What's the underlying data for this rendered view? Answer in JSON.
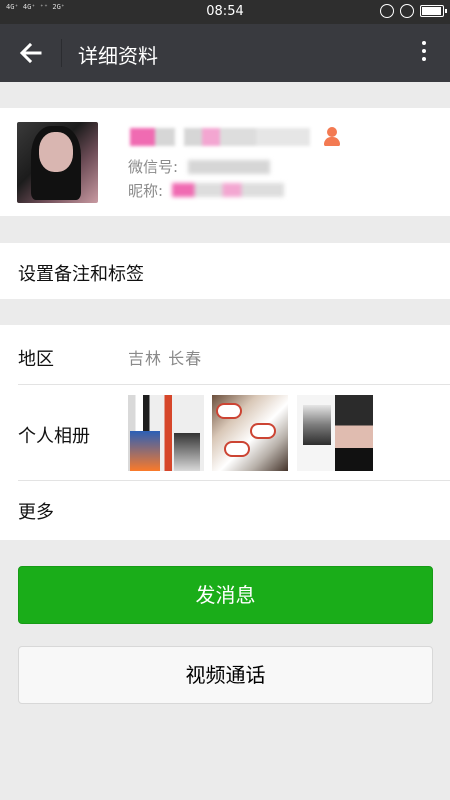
{
  "status_bar": {
    "network": "4G⁺ 4G⁺ ⁺⁺ 2G⁺",
    "time": "08:54"
  },
  "header": {
    "title": "详细资料",
    "back_icon": "arrow-left-icon",
    "more_icon": "more-vertical-icon"
  },
  "profile": {
    "wechat_id_label": "微信号:",
    "nickname_label": "昵称:",
    "gender_icon": "female-icon"
  },
  "remark": {
    "label": "设置备注和标签"
  },
  "info": {
    "region_label": "地区",
    "region_value": "吉林  长春",
    "album_label": "个人相册",
    "more_label": "更多"
  },
  "actions": {
    "send_message": "发消息",
    "video_call": "视频通话"
  },
  "colors": {
    "topbar": "#393a3f",
    "primary": "#1aad19",
    "background": "#ebebeb"
  }
}
